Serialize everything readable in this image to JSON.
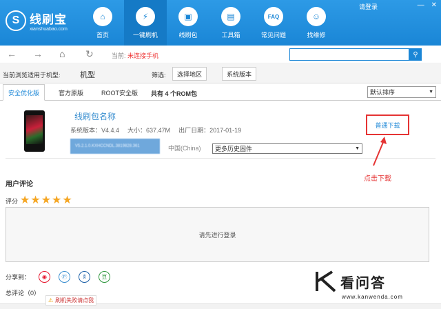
{
  "app": {
    "name": "线刷宝",
    "subtitle": "xianshuabao.com",
    "logo_glyph": "S",
    "login_link": "请登录",
    "window_controls": [
      "—",
      "✕"
    ],
    "accent": "#1a86d6"
  },
  "nav": [
    {
      "label": "首页",
      "icon": "home-icon",
      "glyph": "⌂"
    },
    {
      "label": "一键刷机",
      "icon": "flash-icon",
      "glyph": "⚡"
    },
    {
      "label": "线刷包",
      "icon": "package-icon",
      "glyph": "▣"
    },
    {
      "label": "工具箱",
      "icon": "toolbox-icon",
      "glyph": "▤"
    },
    {
      "label": "常见问题",
      "icon": "faq-icon",
      "glyph": "FAQ"
    },
    {
      "label": "找维修",
      "icon": "repair-icon",
      "glyph": "☺"
    }
  ],
  "address": {
    "back": "←",
    "forward": "→",
    "home": "⌂",
    "refresh": "↻",
    "label": "当前:",
    "value": "未连接手机",
    "search_placeholder": "",
    "search_glyph": "⚲"
  },
  "filter": {
    "model_label": "当前浏览适用于机型:",
    "model_value": "机型",
    "filter_label": "筛选:",
    "region_button": "选择地区",
    "version_button": "系统版本"
  },
  "tabs": [
    "安全优化版",
    "官方原版",
    "ROOT安全版"
  ],
  "rom_count": "共有 4 个ROM包",
  "sort": {
    "value": "默认排序",
    "arrow": "▼"
  },
  "rom": {
    "name": "线刷包名称",
    "version": "系统版本：V4.4.4",
    "size": "大小：637.47M",
    "date": "出厂日期：2017-01-19",
    "version_code": "V5.2.1.0.KXHCCNDL.3819828.361",
    "region": "中国(China)",
    "history_select": "更多历史固件",
    "history_arrow": "▼",
    "download_button": "普通下载"
  },
  "annotation": {
    "text": "点击下载",
    "color": "#e53333"
  },
  "comments": {
    "title": "用户评论",
    "rating_label": "评分",
    "stars": 5,
    "star_glyph": "★",
    "placeholder": "请先进行登录",
    "share_label": "分享到：",
    "share_icons": [
      {
        "name": "weibo-icon",
        "glyph": "◉",
        "color": "#e6162d"
      },
      {
        "name": "qq-zone-icon",
        "glyph": "Ⓟ",
        "color": "#3a8fd0"
      },
      {
        "name": "renren-icon",
        "glyph": "ʬ",
        "color": "#1b5fa7"
      },
      {
        "name": "douban-icon",
        "glyph": "豆",
        "color": "#2e963d"
      }
    ],
    "cut_label": "总评论（0）"
  },
  "fail_link": {
    "text": "刷机失败请点我",
    "glyph": "⚠"
  },
  "watermark": {
    "brand": "看问答",
    "url": "www.kanwenda.com",
    "mark": "K"
  }
}
